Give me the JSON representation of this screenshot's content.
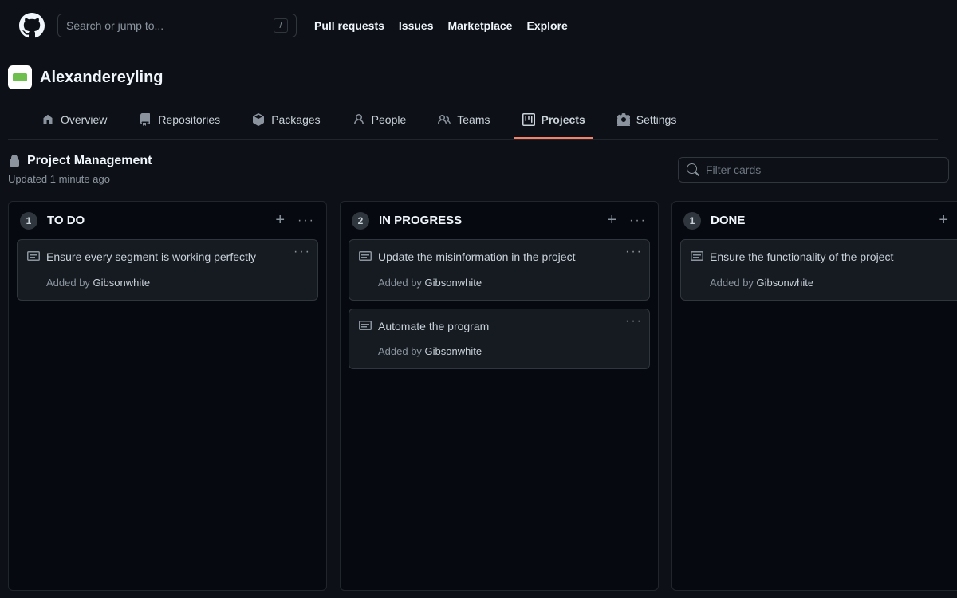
{
  "header": {
    "search_placeholder": "Search or jump to...",
    "slash": "/",
    "nav": [
      "Pull requests",
      "Issues",
      "Marketplace",
      "Explore"
    ]
  },
  "org": {
    "name": "Alexandereyling",
    "tabs": [
      {
        "label": "Overview"
      },
      {
        "label": "Repositories"
      },
      {
        "label": "Packages"
      },
      {
        "label": "People"
      },
      {
        "label": "Teams"
      },
      {
        "label": "Projects"
      },
      {
        "label": "Settings"
      }
    ]
  },
  "project": {
    "title": "Project Management",
    "updated": "Updated 1 minute ago",
    "filter_placeholder": "Filter cards"
  },
  "columns": [
    {
      "count": "1",
      "title": "TO DO",
      "cards": [
        {
          "title": "Ensure every segment is working perfectly",
          "added_by_prefix": "Added by ",
          "author": "Gibsonwhite"
        }
      ]
    },
    {
      "count": "2",
      "title": "IN PROGRESS",
      "cards": [
        {
          "title": "Update the misinformation in the project",
          "added_by_prefix": "Added by ",
          "author": "Gibsonwhite"
        },
        {
          "title": "Automate the program",
          "added_by_prefix": "Added by ",
          "author": "Gibsonwhite"
        }
      ]
    },
    {
      "count": "1",
      "title": "DONE",
      "cards": [
        {
          "title": "Ensure the functionality of the project",
          "added_by_prefix": "Added by ",
          "author": "Gibsonwhite"
        }
      ]
    }
  ]
}
